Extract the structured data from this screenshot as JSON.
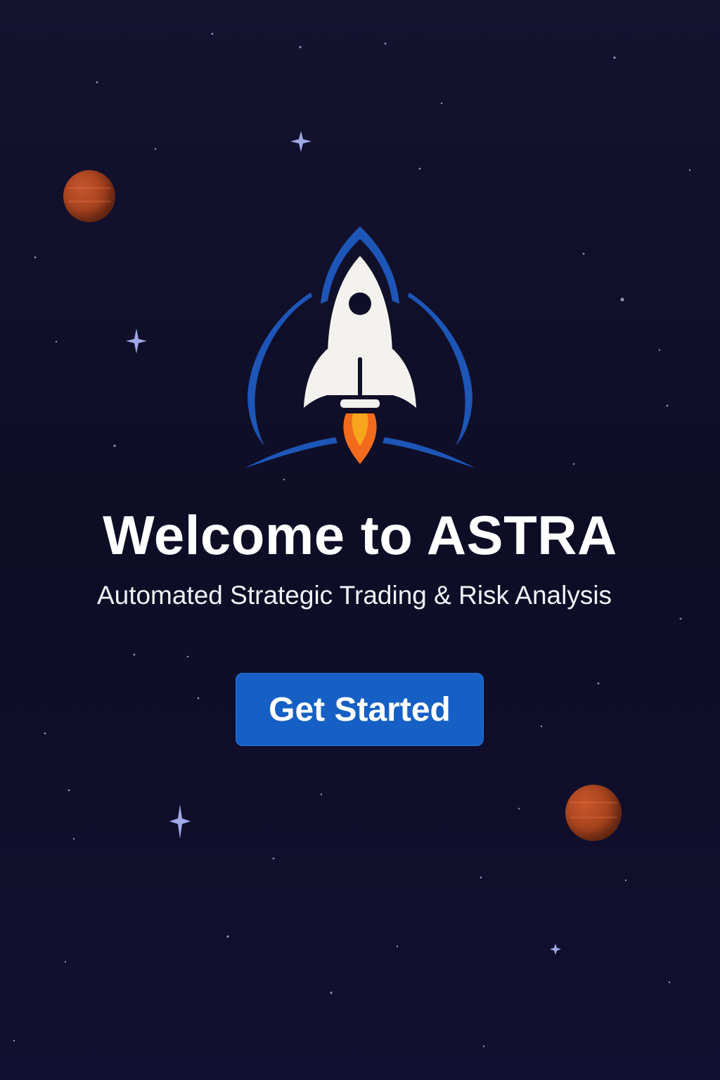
{
  "colors": {
    "background": "#121131",
    "accent": "#1660c5",
    "planet": "#a8431f",
    "flame": "#f26b1d",
    "rocket_body": "#f3f2ee",
    "orbit_arc": "#1e56b8"
  },
  "logo": {
    "icon": "rocket-icon"
  },
  "welcome": {
    "title": "Welcome to ASTRA",
    "subtitle": "Automated Strategic Trading & Risk Analysis"
  },
  "cta": {
    "label": "Get Started"
  }
}
